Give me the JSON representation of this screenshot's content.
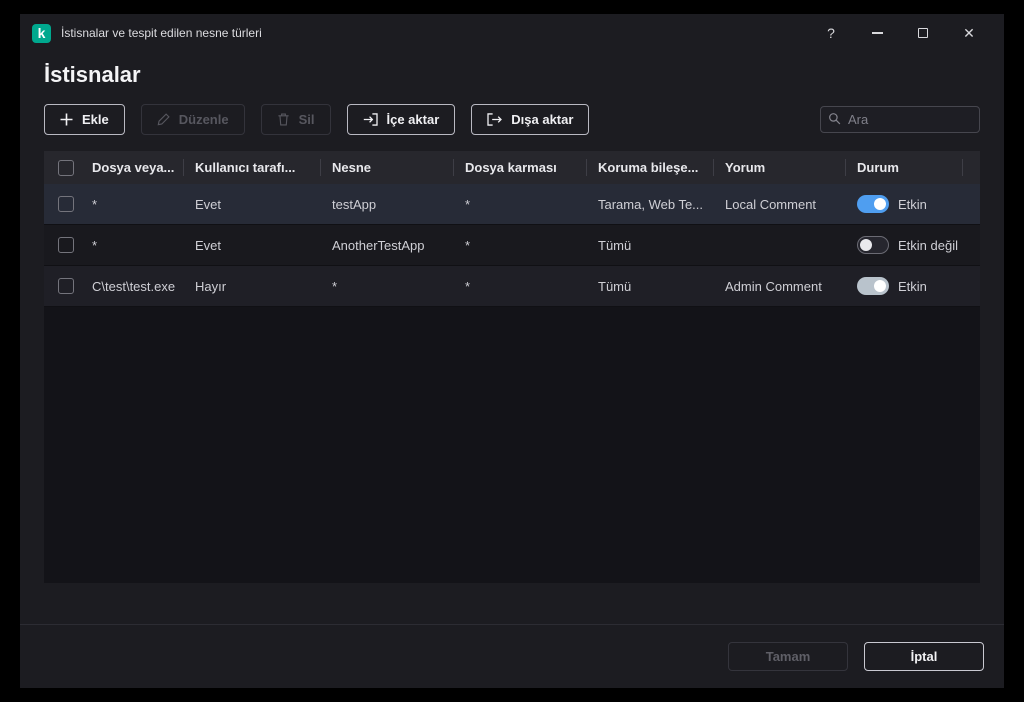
{
  "window": {
    "title": "İstisnalar ve tespit edilen nesne türleri",
    "logo_letter": "k",
    "help": "?",
    "close": "✕"
  },
  "page": {
    "title": "İstisnalar"
  },
  "toolbar": {
    "add_label": "Ekle",
    "edit_label": "Düzenle",
    "delete_label": "Sil",
    "import_label": "İçe aktar",
    "export_label": "Dışa aktar",
    "search_placeholder": "Ara"
  },
  "table": {
    "columns": [
      "Dosya veya...",
      "Kullanıcı tarafı...",
      "Nesne",
      "Dosya karması",
      "Koruma bileşe...",
      "Yorum",
      "Durum"
    ],
    "rows": [
      {
        "file": "*",
        "user": "Evet",
        "object": "testApp",
        "hash": "*",
        "component": "Tarama, Web Te...",
        "comment": "Local Comment",
        "status": "Etkin",
        "toggle": "on-blue",
        "selected": true
      },
      {
        "file": "*",
        "user": "Evet",
        "object": "AnotherTestApp",
        "hash": "*",
        "component": "Tümü",
        "comment": "",
        "status": "Etkin değil",
        "toggle": "off",
        "selected": false
      },
      {
        "file": "C\\test\\test.exe",
        "user": "Hayır",
        "object": "*",
        "hash": "*",
        "component": "Tümü",
        "comment": "Admin Comment",
        "status": "Etkin",
        "toggle": "on-gray",
        "selected": false
      }
    ]
  },
  "footer": {
    "ok_label": "Tamam",
    "cancel_label": "İptal"
  },
  "colors": {
    "logo_green": "#00a88e",
    "toggle_on_blue": "#4f9ef0",
    "toggle_on_gray": "#b9c3cc",
    "window_bg": "#1c1c21",
    "table_bg": "#131318",
    "selected_row_bg": "#272b37"
  },
  "icons": {
    "toolbar": [
      "plus-icon",
      "pencil-icon",
      "trash-icon",
      "import-icon",
      "export-icon"
    ],
    "search": "magnifier-icon",
    "window": [
      "kaspersky-logo-icon",
      "help-button",
      "minimize-icon",
      "maximize-icon",
      "close-icon"
    ]
  }
}
